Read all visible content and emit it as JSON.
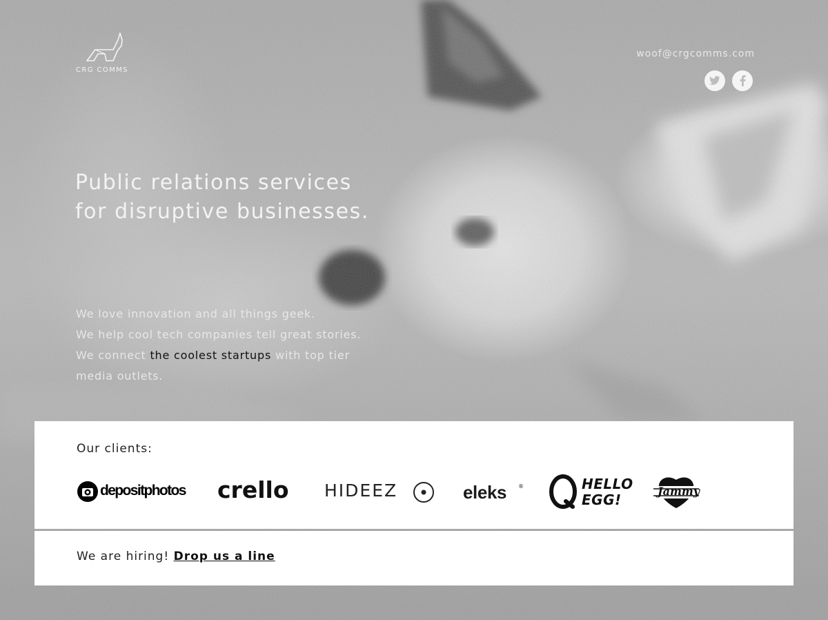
{
  "brand": {
    "name": "CRG COMMS"
  },
  "header": {
    "email": "woof@crgcomms.com",
    "social": [
      "twitter-icon",
      "facebook-icon"
    ]
  },
  "hero": {
    "line1": "Public relations services",
    "line2": "for disruptive businesses."
  },
  "about": {
    "line1": "We love innovation and all things geek.",
    "line2": "We help cool tech companies tell great stories.",
    "line3_before": "We connect ",
    "line3_link": "the coolest startups",
    "line3_after": " with top tier",
    "line4": "media outlets."
  },
  "clients": {
    "title": "Our clients:",
    "items": [
      {
        "name": "depositphotos"
      },
      {
        "name": "crello"
      },
      {
        "name": "HIDEEZ"
      },
      {
        "name": "eleks"
      },
      {
        "name_top": "HELLO",
        "name_bottom": "EGG!"
      },
      {
        "name": "Jammy"
      }
    ]
  },
  "hiring": {
    "text": "We are hiring! ",
    "link": "Drop us a line"
  },
  "colors": {
    "panel": "#ffffff",
    "text_dark": "#222222",
    "hero_text": "#f3f3f3"
  }
}
